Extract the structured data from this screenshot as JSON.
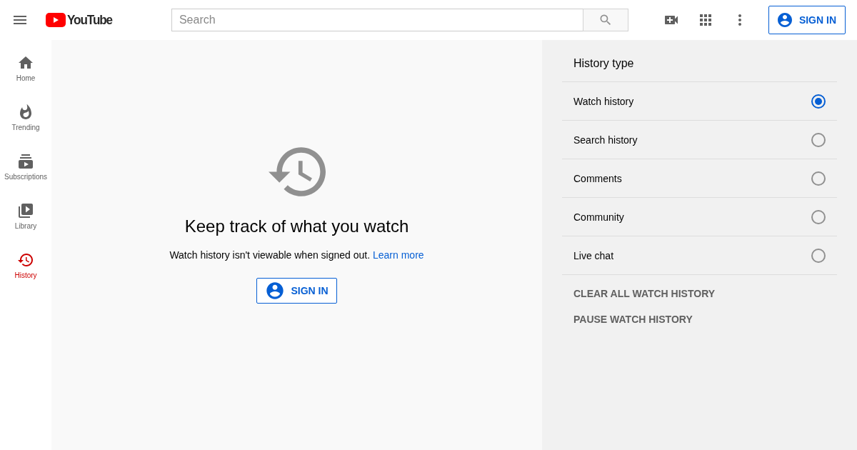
{
  "header": {
    "logo": "YouTube",
    "search": {
      "placeholder": "Search"
    },
    "sign_in": "SIGN IN"
  },
  "sidebar": {
    "items": [
      {
        "label": "Home",
        "kind": "home",
        "selected": false
      },
      {
        "label": "Trending",
        "kind": "trending",
        "selected": false
      },
      {
        "label": "Subscriptions",
        "kind": "subscriptions",
        "selected": false
      },
      {
        "label": "Library",
        "kind": "library",
        "selected": false
      },
      {
        "label": "History",
        "kind": "history",
        "selected": true
      }
    ]
  },
  "main": {
    "title": "Keep track of what you watch",
    "message": "Watch history isn't viewable when signed out.",
    "link": "Learn more",
    "sign_in": "SIGN IN"
  },
  "panel": {
    "title": "History type",
    "options": [
      {
        "label": "Watch history",
        "selected": true
      },
      {
        "label": "Search history",
        "selected": false
      },
      {
        "label": "Comments",
        "selected": false
      },
      {
        "label": "Community",
        "selected": false
      },
      {
        "label": "Live chat",
        "selected": false
      }
    ],
    "actions": [
      "CLEAR ALL WATCH HISTORY",
      "PAUSE WATCH HISTORY"
    ]
  }
}
